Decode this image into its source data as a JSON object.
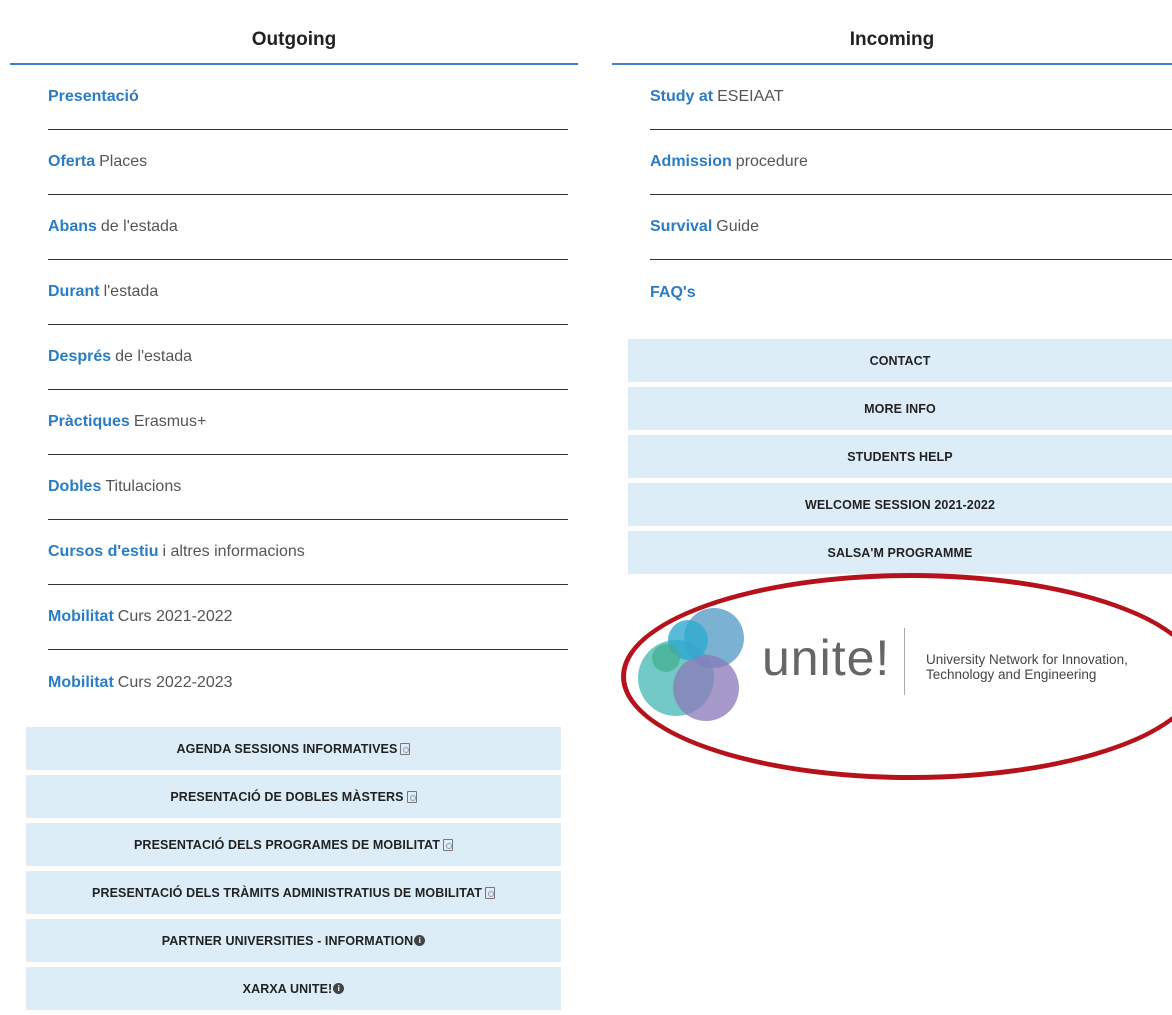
{
  "outgoing": {
    "title": "Outgoing",
    "links": [
      {
        "key": "Presentació",
        "rest": ""
      },
      {
        "key": "Oferta",
        "rest": "Places"
      },
      {
        "key": "Abans",
        "rest": "de l'estada"
      },
      {
        "key": "Durant",
        "rest": "l'estada"
      },
      {
        "key": "Després",
        "rest": "de l'estada"
      },
      {
        "key": "Pràctiques",
        "rest": "Erasmus+"
      },
      {
        "key": "Dobles",
        "rest": "Titulacions"
      },
      {
        "key": "Cursos d'estiu",
        "rest": "i altres informacions"
      },
      {
        "key": "Mobilitat",
        "rest": "Curs 2021-2022"
      },
      {
        "key": "Mobilitat",
        "rest": "Curs 2022-2023"
      }
    ],
    "buttons": [
      {
        "label": "AGENDA SESSIONS INFORMATIVES",
        "icon": "pdf-icon"
      },
      {
        "label": "PRESENTACIÓ DE DOBLES MÀSTERS",
        "icon": "pdf-icon"
      },
      {
        "label": "PRESENTACIÓ DELS PROGRAMES DE MOBILITAT",
        "icon": "pdf-icon"
      },
      {
        "label": "PRESENTACIÓ DELS TRÀMITS ADMINISTRATIUS DE MOBILITAT",
        "icon": "pdf-icon"
      },
      {
        "label": "PARTNER UNIVERSITIES - INFORMATION",
        "icon": "info-icon"
      },
      {
        "label": "XARXA UNITE!",
        "icon": "info-icon"
      }
    ]
  },
  "incoming": {
    "title": "Incoming",
    "links": [
      {
        "key": "Study at",
        "rest": "ESEIAAT"
      },
      {
        "key": "Admission",
        "rest": "procedure"
      },
      {
        "key": "Survival",
        "rest": "Guide"
      },
      {
        "key": "FAQ's",
        "rest": ""
      }
    ],
    "buttons": [
      {
        "label": "CONTACT"
      },
      {
        "label": "MORE INFO"
      },
      {
        "label": "STUDENTS HELP"
      },
      {
        "label": "WELCOME SESSION 2021-2022"
      },
      {
        "label": "SALSA'M PROGRAMME"
      }
    ]
  },
  "logo": {
    "word": "unite!",
    "tagline_line1": "University Network for Innovation,",
    "tagline_line2": "Technology and Engineering"
  },
  "colors": {
    "link_blue": "#2a7cc4",
    "button_bg": "#dcedf8",
    "annotation_red": "#b5121b"
  }
}
